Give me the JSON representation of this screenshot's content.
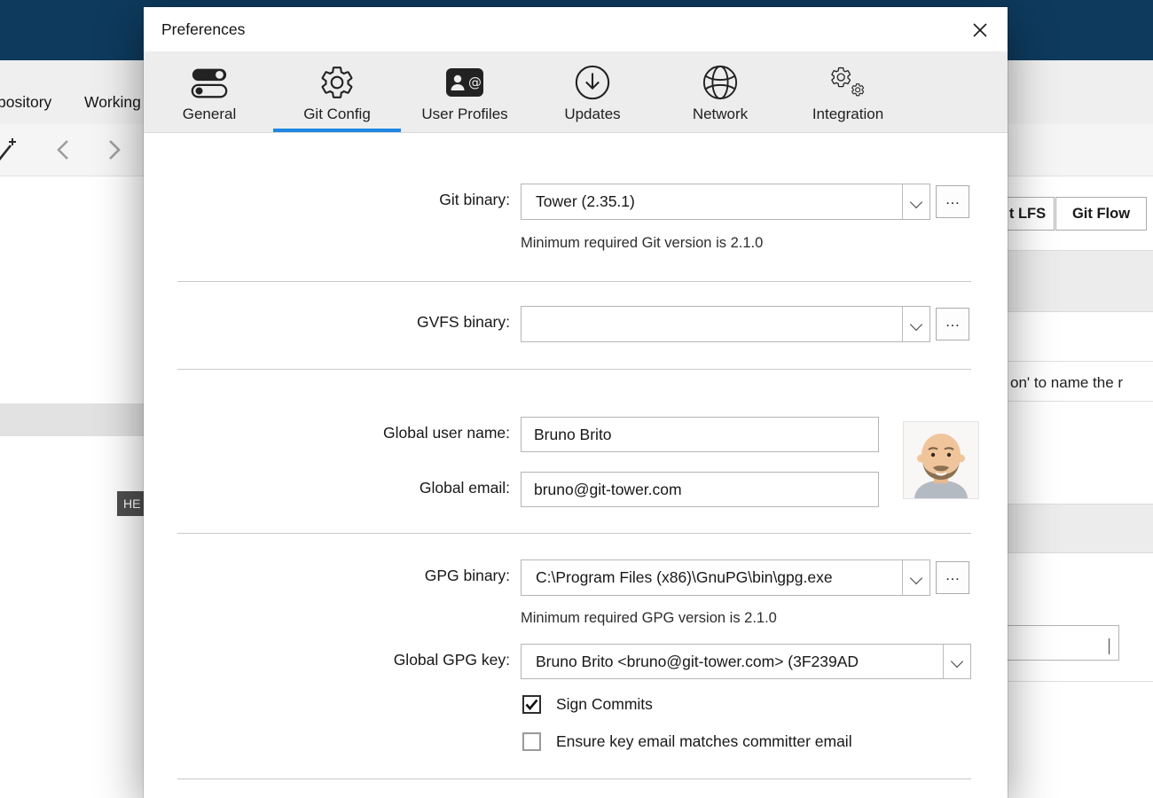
{
  "colors": {
    "accent": "#1f87e3",
    "app_titlebar": "#0e3a5d"
  },
  "background": {
    "menu_items": [
      {
        "label": "pository"
      },
      {
        "label": "Working"
      }
    ],
    "toolbar_buttons": {
      "git_lfs": "t LFS",
      "git_flow": "Git Flow"
    },
    "hint_fragment": "on' to name the r",
    "head_badge": "HE"
  },
  "dialog": {
    "title": "Preferences",
    "tabs": [
      {
        "label": "General",
        "active": false
      },
      {
        "label": "Git Config",
        "active": true
      },
      {
        "label": "User Profiles",
        "active": false
      },
      {
        "label": "Updates",
        "active": false
      },
      {
        "label": "Network",
        "active": false
      },
      {
        "label": "Integration",
        "active": false
      }
    ],
    "git_binary": {
      "label": "Git binary:",
      "value": "Tower (2.35.1)",
      "hint": "Minimum required Git version is 2.1.0",
      "browse": "…"
    },
    "gvfs_binary": {
      "label": "GVFS binary:",
      "value": "",
      "browse": "…"
    },
    "global_user_name": {
      "label": "Global user name:",
      "value": "Bruno Brito"
    },
    "global_email": {
      "label": "Global email:",
      "value": "bruno@git-tower.com"
    },
    "gpg_binary": {
      "label": "GPG binary:",
      "value": "C:\\Program Files (x86)\\GnuPG\\bin\\gpg.exe",
      "hint": "Minimum required GPG version is 2.1.0",
      "browse": "…"
    },
    "global_gpg_key": {
      "label": "Global GPG key:",
      "value": "Bruno Brito <bruno@git-tower.com> (3F239AD"
    },
    "sign_commits": {
      "label": "Sign Commits",
      "checked": true
    },
    "ensure_key_email": {
      "label": "Ensure key email matches committer email",
      "checked": false
    }
  }
}
